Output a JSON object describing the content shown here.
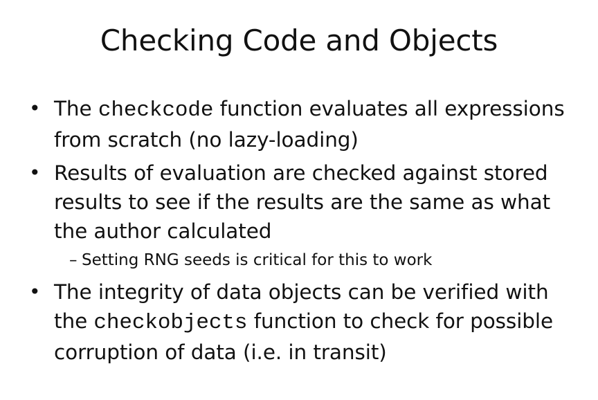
{
  "slide": {
    "title": "Checking Code and Objects",
    "bullet_marker": "•",
    "sub_marker": "–",
    "bullets": [
      {
        "pre": "The ",
        "code": "checkcode",
        "post": " function evaluates all expressions from scratch (no lazy-loading)"
      },
      {
        "text": "Results of evaluation are checked against stored results to see if the results are the same as what the author calculated",
        "sub": "Setting RNG seeds is critical for this to work"
      },
      {
        "pre": "The integrity of data objects can be verified with the ",
        "code": "checkobjects",
        "post": " function to check for possible corruption of data (i.e. in transit)"
      }
    ]
  }
}
